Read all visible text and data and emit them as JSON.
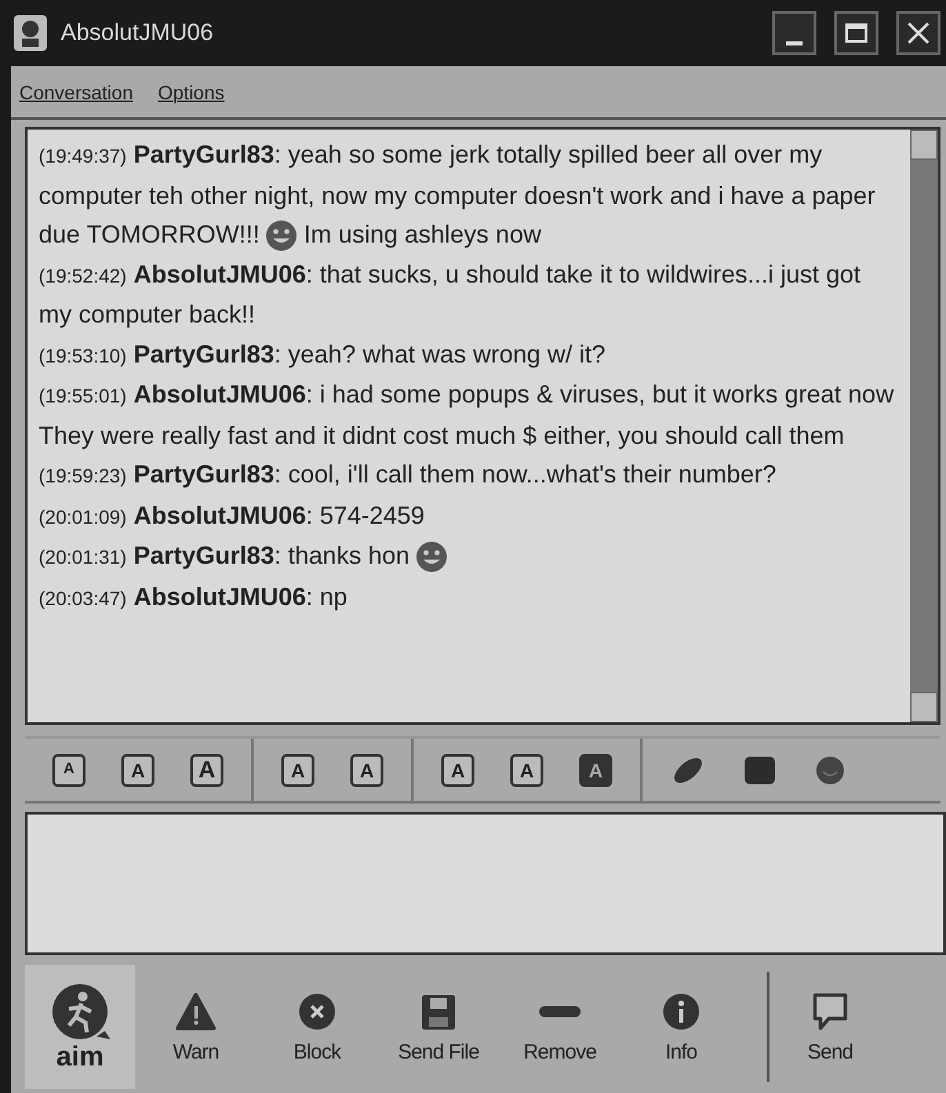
{
  "window": {
    "title": "AbsolutJMU06"
  },
  "menu": [
    "Conversation",
    "Options"
  ],
  "messages": [
    {
      "time": "(19:49:37)",
      "sender": "PartyGurl83",
      "parts": [
        {
          "kind": "text",
          "text": ": yeah so some jerk totally spilled beer all over my computer teh other night, now my computer doesn't work and i have a paper due TOMORROW!!!"
        },
        {
          "kind": "emoji"
        },
        {
          "kind": "text",
          "text": "Im using ashleys now"
        }
      ]
    },
    {
      "time": "(19:52:42)",
      "sender": "AbsolutJMU06",
      "parts": [
        {
          "kind": "text",
          "text": ": that sucks,  u should take it to wildwires...i just got my computer back!!"
        }
      ]
    },
    {
      "time": "(19:53:10)",
      "sender": "PartyGurl83",
      "parts": [
        {
          "kind": "text",
          "text": ": yeah? what was wrong w/ it?"
        }
      ]
    },
    {
      "time": "(19:55:01)",
      "sender": "AbsolutJMU06",
      "parts": [
        {
          "kind": "text",
          "text": ": i had some popups & viruses, but it works great now  They were really fast and it didnt cost much $ either, you should call them"
        }
      ]
    },
    {
      "time": "(19:59:23)",
      "sender": "PartyGurl83",
      "parts": [
        {
          "kind": "text",
          "text": ": cool, i'll call them now...what's their number?"
        }
      ]
    },
    {
      "time": "(20:01:09)",
      "sender": "AbsolutJMU06",
      "parts": [
        {
          "kind": "text",
          "text": ": 574-2459"
        }
      ]
    },
    {
      "time": "(20:01:31)",
      "sender": "PartyGurl83",
      "parts": [
        {
          "kind": "text",
          "text": ": thanks hon"
        },
        {
          "kind": "emoji"
        }
      ]
    },
    {
      "time": "(20:03:47)",
      "sender": "AbsolutJMU06",
      "parts": [
        {
          "kind": "text",
          "text": ": np"
        }
      ]
    }
  ],
  "toolbar": [
    [
      {
        "kind": "small",
        "label": "A"
      },
      {
        "kind": "normal",
        "label": "A"
      },
      {
        "kind": "large",
        "label": "A"
      }
    ],
    [
      {
        "kind": "normal",
        "label": "A"
      },
      {
        "kind": "normal",
        "label": "A"
      }
    ],
    [
      {
        "kind": "normal",
        "label": "A"
      },
      {
        "kind": "normal",
        "label": "A"
      },
      {
        "kind": "inverted",
        "label": "A"
      }
    ],
    [
      {
        "kind": "link"
      },
      {
        "kind": "image"
      },
      {
        "kind": "smiley"
      }
    ]
  ],
  "logo": "aim",
  "actions": [
    {
      "kind": "warn",
      "label": "Warn"
    },
    {
      "kind": "block",
      "label": "Block"
    },
    {
      "kind": "file",
      "label": "Send File"
    },
    {
      "kind": "remove",
      "label": "Remove"
    },
    {
      "kind": "info",
      "label": "Info"
    }
  ],
  "send": {
    "label": "Send"
  }
}
